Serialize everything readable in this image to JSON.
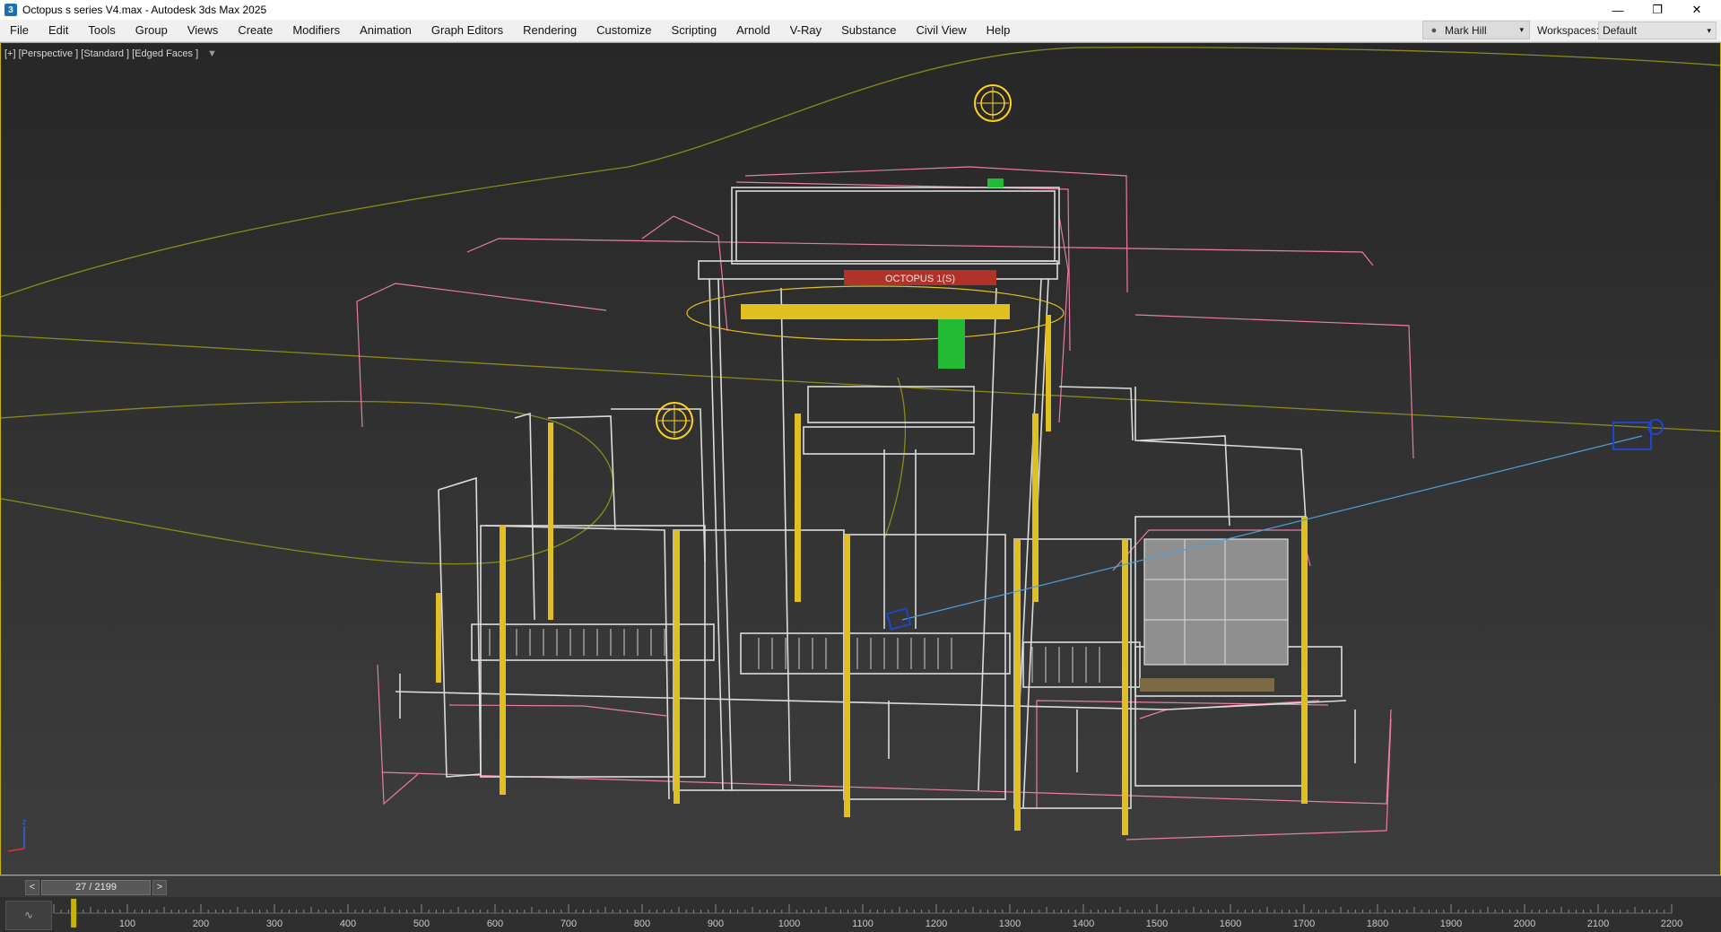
{
  "window": {
    "title": "Octopus s series V4.max - Autodesk 3ds Max 2025",
    "app_icon": "3",
    "controls": {
      "minimize": "—",
      "restore": "❐",
      "close": "✕"
    }
  },
  "menu": [
    {
      "label": "File"
    },
    {
      "label": "Edit"
    },
    {
      "label": "Tools"
    },
    {
      "label": "Group"
    },
    {
      "label": "Views"
    },
    {
      "label": "Create"
    },
    {
      "label": "Modifiers"
    },
    {
      "label": "Animation"
    },
    {
      "label": "Graph Editors"
    },
    {
      "label": "Rendering"
    },
    {
      "label": "Customize"
    },
    {
      "label": "Scripting"
    },
    {
      "label": "Arnold"
    },
    {
      "label": "V-Ray"
    },
    {
      "label": "Substance"
    },
    {
      "label": "Civil View"
    },
    {
      "label": "Help"
    }
  ],
  "user": {
    "name": "Mark Hill",
    "icon": "user-icon",
    "caret": "▾"
  },
  "workspaces": {
    "label": "Workspaces:",
    "value": "Default",
    "caret": "▾"
  },
  "viewport": {
    "label": "[+] [Perspective ] [Standard ] [Edged Faces ]",
    "filter_icon": "filter-icon",
    "machine_sign": "OCTOPUS 1(S)",
    "colors": {
      "border": "#c8b400",
      "wire_white": "#dcdcdc",
      "wire_pink": "#e87ba8",
      "wire_yellow": "#e0c020",
      "spline_olive": "#8a8a1a",
      "camera_blue": "#2244cc",
      "camera_line": "#4aa0e0",
      "light_yellow": "#ffd21f",
      "motor_green": "#22bb33"
    }
  },
  "timeslider": {
    "prev": "<",
    "next": ">",
    "frame": "27 / 2199"
  },
  "trackbar": {
    "curve_icon": "curve-editor-icon",
    "ticks": [
      "100",
      "200",
      "300",
      "400",
      "500",
      "600",
      "700",
      "800",
      "900",
      "1000",
      "1100",
      "1200",
      "1300",
      "1400",
      "1500",
      "1600",
      "1700",
      "1800",
      "1900",
      "2000",
      "2100",
      "2200"
    ]
  }
}
